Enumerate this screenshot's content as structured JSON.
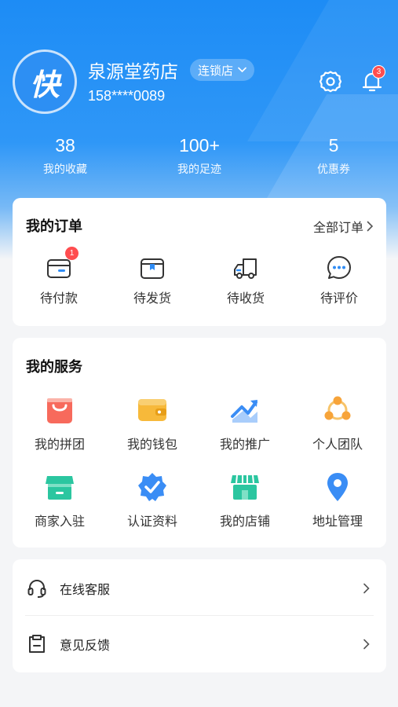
{
  "header": {
    "avatar_text": "快",
    "shop_name": "泉源堂药店",
    "chain_label": "连锁店",
    "phone": "158****0089",
    "notification_count": "3"
  },
  "stats": [
    {
      "value": "38",
      "label": "我的收藏"
    },
    {
      "value": "100+",
      "label": "我的足迹"
    },
    {
      "value": "5",
      "label": "优惠券"
    }
  ],
  "orders": {
    "title": "我的订单",
    "all_label": "全部订单",
    "items": [
      {
        "label": "待付款",
        "badge": "1",
        "icon": "wallet-card-icon"
      },
      {
        "label": "待发货",
        "icon": "package-box-icon"
      },
      {
        "label": "待收货",
        "icon": "delivery-truck-icon"
      },
      {
        "label": "待评价",
        "icon": "chat-bubble-icon"
      }
    ]
  },
  "services": {
    "title": "我的服务",
    "items": [
      {
        "label": "我的拼团",
        "icon": "shopping-bag-icon",
        "color": "#f76a5c"
      },
      {
        "label": "我的钱包",
        "icon": "wallet-icon",
        "color": "#f7b93a"
      },
      {
        "label": "我的推广",
        "icon": "trend-chart-icon",
        "color": "#3a8df5"
      },
      {
        "label": "个人团队",
        "icon": "team-icon",
        "color": "#f7a43a"
      },
      {
        "label": "商家入驻",
        "icon": "storefront-icon",
        "color": "#2bc6a0"
      },
      {
        "label": "认证资料",
        "icon": "verified-badge-icon",
        "color": "#3a8df5"
      },
      {
        "label": "我的店铺",
        "icon": "shop-icon",
        "color": "#2bc6a0"
      },
      {
        "label": "地址管理",
        "icon": "location-pin-icon",
        "color": "#3a8df5"
      }
    ]
  },
  "menu": [
    {
      "label": "在线客服",
      "icon": "headset-icon"
    },
    {
      "label": "意见反馈",
      "icon": "feedback-clipboard-icon"
    }
  ],
  "colors": {
    "primary": "#1d8cf5",
    "badge": "#ff4d4f",
    "page_bg": "#f4f5f7"
  }
}
